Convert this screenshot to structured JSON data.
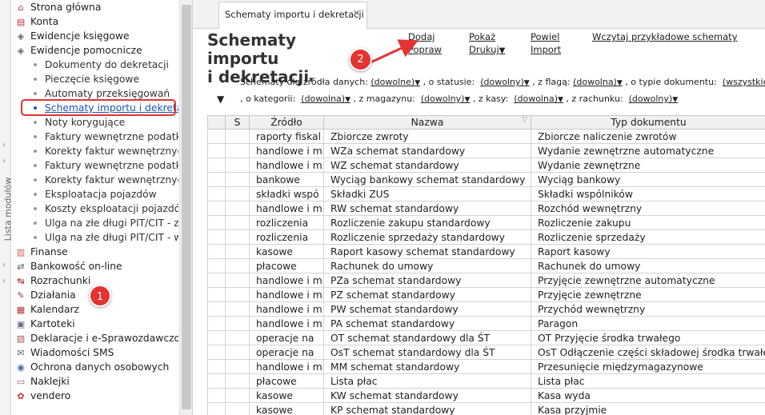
{
  "left_strip": {
    "label": "Lista modułów"
  },
  "nav": {
    "items_top": [
      {
        "label": "Strona główna",
        "icon": "home-icon",
        "glyph": "⌂",
        "color": "#b33"
      },
      {
        "label": "Konta",
        "icon": "accounts-icon",
        "glyph": "▤",
        "color": "#b33"
      },
      {
        "label": "Ewidencje księgowe",
        "icon": "ledger-icon",
        "glyph": "◈",
        "color": "#666"
      },
      {
        "label": "Ewidencje pomocnicze",
        "icon": "aux-ledger-icon",
        "glyph": "◈",
        "color": "#666"
      }
    ],
    "sub_items": [
      "Dokumenty do dekretacji",
      "Pieczęcie księgowe",
      "Automaty przeksięgowań",
      "Schematy importu i dekretacji",
      "Noty korygujące",
      "Faktury wewnętrzne podatku naliczonego",
      "Korekty faktur wewnętrznych podatku",
      "Faktury wewnętrzne podatku należnego",
      "Korekty faktur wewnętrznych podatku",
      "Eksploatacja pojazdów",
      "Koszty eksploatacji pojazdów",
      "Ulga na złe długi PIT/CIT - zobowiązania",
      "Ulga na złe długi PIT/CIT - wierzytelności"
    ],
    "active_sub": 3,
    "items_bottom": [
      {
        "label": "Finanse",
        "icon": "finance-icon",
        "glyph": "▥",
        "color": "#c55"
      },
      {
        "label": "Bankowość on-line",
        "icon": "bank-icon",
        "glyph": "⇄",
        "color": "#555"
      },
      {
        "label": "Rozrachunki",
        "icon": "settlements-icon",
        "glyph": "↹",
        "color": "#a33"
      },
      {
        "label": "Działania",
        "icon": "actions-icon",
        "glyph": "✎",
        "color": "#a33"
      },
      {
        "label": "Kalendarz",
        "icon": "calendar-icon",
        "glyph": "▦",
        "color": "#b33"
      },
      {
        "label": "Kartoteki",
        "icon": "files-icon",
        "glyph": "▣",
        "color": "#668"
      },
      {
        "label": "Deklaracje i e-Sprawozdawczość",
        "icon": "declarations-icon",
        "glyph": "▧",
        "color": "#a55"
      },
      {
        "label": "Wiadomości SMS",
        "icon": "sms-icon",
        "glyph": "✉",
        "color": "#666"
      },
      {
        "label": "Ochrona danych osobowych",
        "icon": "data-protection-icon",
        "glyph": "◉",
        "color": "#46a"
      },
      {
        "label": "Naklejki",
        "icon": "stickers-icon",
        "glyph": "▭",
        "color": "#a55"
      },
      {
        "label": "vendero",
        "icon": "vendero-icon",
        "glyph": "✿",
        "color": "#c33"
      }
    ]
  },
  "annotations": {
    "badge1": "1",
    "badge2": "2",
    "accent": "#e53232"
  },
  "tab": {
    "label": "Schematy importu i dekretacji",
    "close": "✕"
  },
  "page": {
    "title_line1": "Schematy importu",
    "title_line2": "i dekretacji",
    "title_arrow": "▾"
  },
  "actions": {
    "dodaj": "Dodaj",
    "popraw": "Popraw",
    "pokaz": "Pokaż",
    "drukuj": "Drukuj",
    "powiel": "Powiel",
    "import": "Import",
    "wczytaj": "Wczytaj przykładowe schematy",
    "caret": "▼"
  },
  "filters": {
    "zrodlo_label": "Schematy dla źródła danych:",
    "zrodlo_value": "(dowolne)",
    "status_label": ", o statusie:",
    "status_value": "(dowolny)",
    "flaga_label": ", z flagą:",
    "flaga_value": "(dowolna)",
    "typ_label": ", o typie dokumentu:",
    "typ_value": "(wszystkie)",
    "kategoria_label": ", o kategorii:",
    "kategoria_value": "(dowolna)",
    "magazyn_label": ", z magazynu:",
    "magazyn_value": "(dowolny)",
    "kasa_label": ", z kasy:",
    "kasa_value": "(dowolna)",
    "rachunek_label": ", z rachunku:",
    "rachunek_value": "(dowolny)",
    "caret": "▼",
    "expand": "▼"
  },
  "table": {
    "headers": [
      "S",
      "Źródło",
      "Nazwa",
      "Typ dokumentu"
    ],
    "sort_mark": "▽",
    "rows": [
      [
        "raporty fiskal",
        "Zbiorcze zwroty",
        "Zbiorcze naliczenie zwrotów"
      ],
      [
        "handlowe i m",
        "WZa schemat standardowy",
        "Wydanie zewnętrzne automatyczne"
      ],
      [
        "handlowe i m",
        "WZ schemat standardowy",
        "Wydanie zewnętrzne"
      ],
      [
        "bankowe",
        "Wyciąg bankowy schemat standardowy",
        "Wyciąg bankowy"
      ],
      [
        "składki wspó",
        "Składki ZUS",
        "Składki wspólników"
      ],
      [
        "handlowe i m",
        "RW schemat standardowy",
        "Rozchód wewnętrzny"
      ],
      [
        "rozliczenia",
        "Rozliczenie zakupu standardowy",
        "Rozliczenie zakupu"
      ],
      [
        "rozliczenia",
        "Rozliczenie sprzedaży standardowy",
        "Rozliczenie sprzedaży"
      ],
      [
        "kasowe",
        "Raport kasowy schemat standardowy",
        "Raport kasowy"
      ],
      [
        "płacowe",
        "Rachunek do umowy",
        "Rachunek do umowy"
      ],
      [
        "handlowe i m",
        "PZa schemat standardowy",
        "Przyjęcie zewnętrzne automatyczne"
      ],
      [
        "handlowe i m",
        "PZ schemat standardowy",
        "Przyjęcie zewnętrzne"
      ],
      [
        "handlowe i m",
        "PW schemat standardowy",
        "Przychód wewnętrzny"
      ],
      [
        "handlowe i m",
        "PA schemat standardowy",
        "Paragon"
      ],
      [
        "operacje na",
        "OT schemat standardowy dla ŚT",
        "OT Przyjęcie środka trwałego"
      ],
      [
        "operacje na",
        "OsT schemat standardowy dla ŚT",
        "OsT Odłączenie części składowej środka trwałego"
      ],
      [
        "handlowe i m",
        "MM schemat standardowy",
        "Przesunięcie międzymagazynowe"
      ],
      [
        "płacowe",
        "Lista płac",
        "Lista płac"
      ],
      [
        "kasowe",
        "KW schemat standardowy",
        "Kasa wyda"
      ],
      [
        "kasowe",
        "KP schemat standardowy",
        "Kasa przyjmie"
      ]
    ]
  }
}
